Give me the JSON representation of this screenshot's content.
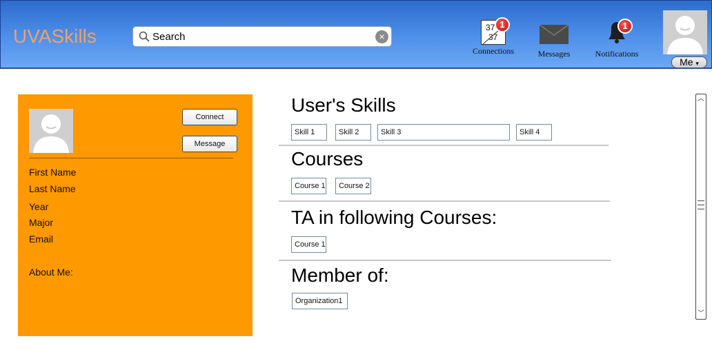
{
  "header": {
    "brand": "UVASkills",
    "search": {
      "placeholder": "Search"
    },
    "nav": {
      "connections": {
        "label": "Connections",
        "calendar_top": "37",
        "calendar_bottom": "37",
        "badge": "1"
      },
      "messages": {
        "label": "Messages"
      },
      "notifications": {
        "label": "Notifications",
        "badge": "1"
      }
    },
    "me_label": "Me",
    "me_caret": "▾"
  },
  "profile": {
    "connect_label": "Connect",
    "message_label": "Message",
    "fields": [
      "First Name",
      "Last Name",
      "Year",
      "Major",
      "Email"
    ],
    "about_label": "About Me:"
  },
  "main": {
    "skills": {
      "title": "User's Skills",
      "items": [
        "Skill 1",
        "Skill 2",
        "Skill 3",
        "Skill 4"
      ]
    },
    "courses": {
      "title": "Courses",
      "items": [
        "Course 1",
        "Course 2"
      ]
    },
    "ta": {
      "title": "TA in following Courses:",
      "items": [
        "Course 1"
      ]
    },
    "member": {
      "title": "Member of:",
      "items": [
        "Organization1"
      ]
    }
  },
  "colors": {
    "header": "#4f90ea",
    "brand": "#f2a062",
    "profile_panel": "#ff9900",
    "badge": "#d61c1c"
  },
  "icons": [
    "search-icon",
    "clear-icon",
    "calendar-icon",
    "envelope-icon",
    "bell-icon",
    "avatar-icon",
    "chevron-up-icon",
    "chevron-down-icon"
  ]
}
